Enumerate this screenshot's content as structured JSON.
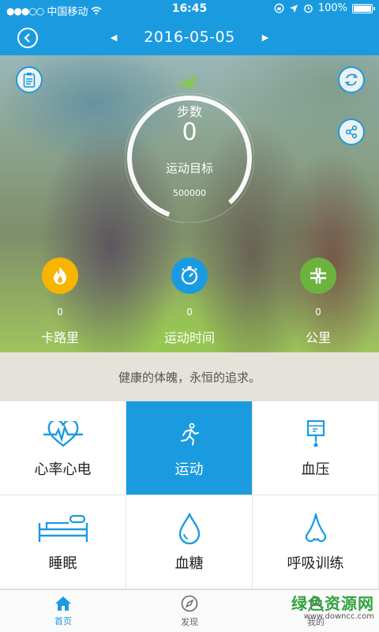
{
  "status": {
    "carrier": "中国移动",
    "time": "16:45",
    "battery": "100%"
  },
  "header": {
    "date": "2016-05-05"
  },
  "ring": {
    "steps_label": "步数",
    "steps_value": "0",
    "goal_label": "运动目标",
    "goal_value": "500000"
  },
  "stats": [
    {
      "value": "0",
      "label": "卡路里",
      "color": "#f7b500",
      "icon": "flame-icon"
    },
    {
      "value": "0",
      "label": "运动时间",
      "color": "#1a9be0",
      "icon": "stopwatch-icon"
    },
    {
      "value": "0",
      "label": "公里",
      "color": "#6cb33e",
      "icon": "route-icon"
    }
  ],
  "slogan": "健康的体魄，永恒的追求。",
  "grid": [
    {
      "label": "心率心电",
      "icon": "heartbeat-icon"
    },
    {
      "label": "运动",
      "icon": "runner-icon"
    },
    {
      "label": "血压",
      "icon": "blood-pressure-icon"
    },
    {
      "label": "睡眠",
      "icon": "bed-icon"
    },
    {
      "label": "血糖",
      "icon": "drop-icon"
    },
    {
      "label": "呼吸训练",
      "icon": "nose-icon"
    }
  ],
  "tabs": [
    {
      "label": "首页",
      "icon": "home-icon"
    },
    {
      "label": "发现",
      "icon": "compass-icon"
    },
    {
      "label": "我的",
      "icon": "user-icon"
    }
  ],
  "watermark": {
    "title": "绿色资源网",
    "url": "www.downcc.com"
  },
  "colors": {
    "primary": "#1a9be0",
    "calorie": "#f7b500",
    "distance": "#6cb33e"
  }
}
